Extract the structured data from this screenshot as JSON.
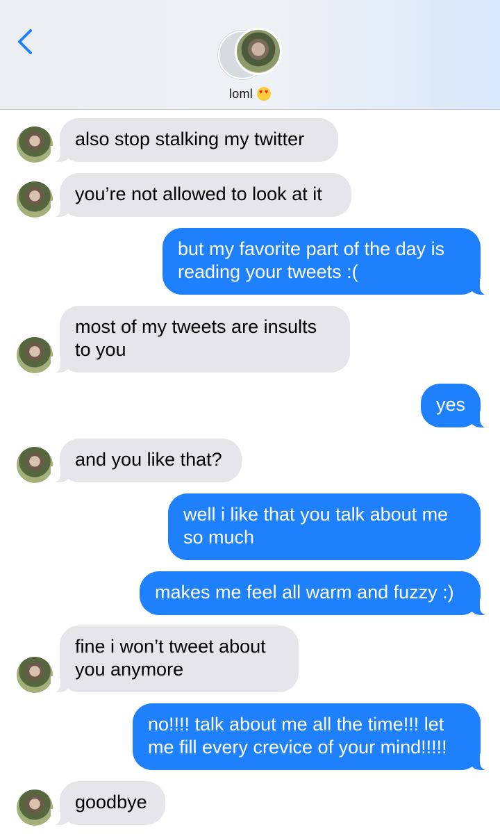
{
  "header": {
    "contact_name": "loml",
    "contact_emoji": "heart-eyes-emoji"
  },
  "messages": [
    {
      "from": "them",
      "text": "also stop stalking my twitter"
    },
    {
      "from": "them",
      "text": "you’re not allowed to look at it"
    },
    {
      "from": "me",
      "lines": [
        "but my favorite part of the day is",
        "reading your tweets :("
      ]
    },
    {
      "from": "them",
      "lines": [
        "most of my tweets are insults",
        "to you"
      ]
    },
    {
      "from": "me",
      "text": "yes"
    },
    {
      "from": "them",
      "text": "and you like that?"
    },
    {
      "from": "me",
      "lines": [
        "well i like that you talk about me",
        "so much"
      ]
    },
    {
      "from": "me",
      "text": "makes me feel all warm and fuzzy :)"
    },
    {
      "from": "them",
      "lines": [
        "fine i won’t tweet about",
        "you anymore"
      ]
    },
    {
      "from": "me",
      "lines": [
        "no!!!! talk about me all the time!!! let",
        "me fill every crevice of your mind!!!!!"
      ]
    },
    {
      "from": "them",
      "text": "goodbye"
    }
  ],
  "colors": {
    "incoming_bubble": "#e5e5ea",
    "outgoing_bubble": "#1e80fa",
    "accent": "#1e80fa"
  }
}
